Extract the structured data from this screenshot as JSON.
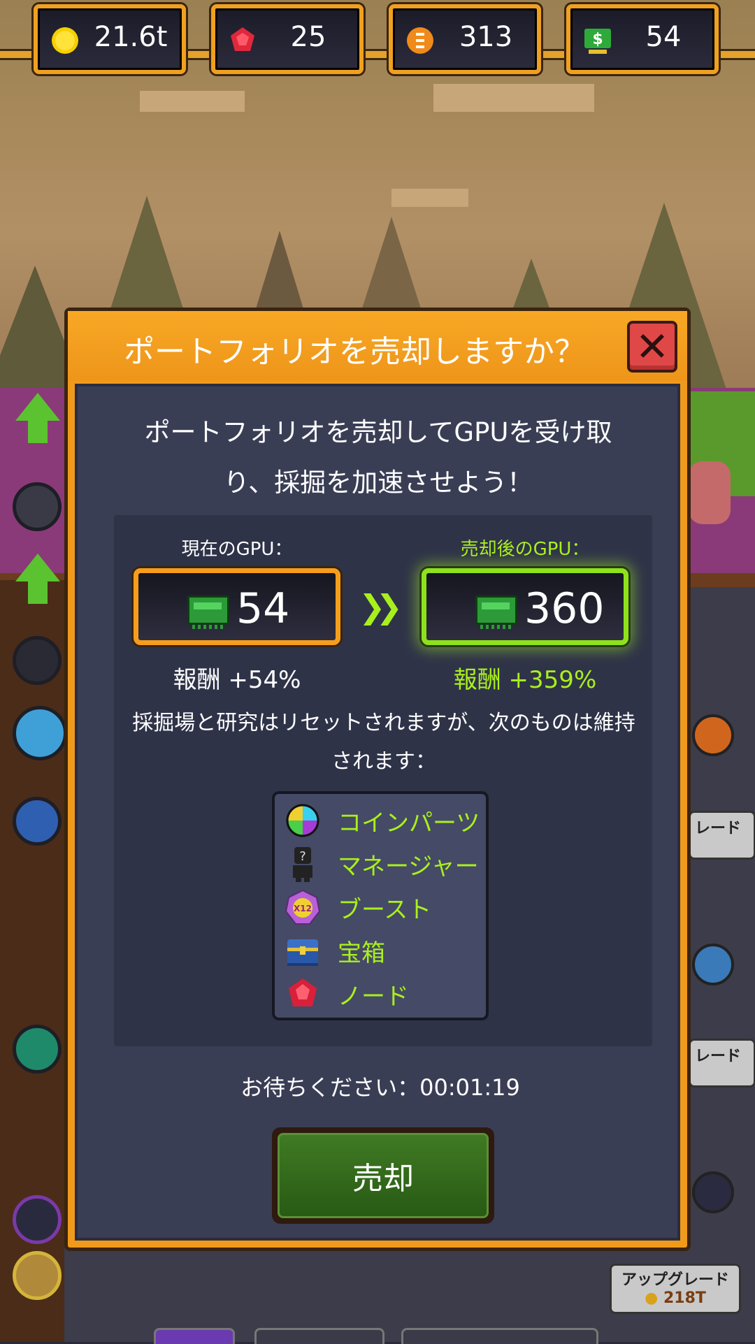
{
  "resources": [
    {
      "icon": "gold-coin-icon",
      "value": "21.6t"
    },
    {
      "icon": "red-gem-icon",
      "value": "25"
    },
    {
      "icon": "orange-token-icon",
      "value": "313"
    },
    {
      "icon": "cash-icon",
      "value": "54"
    }
  ],
  "modal": {
    "title": "ポートフォリオを売却しますか？",
    "intro_line1": "ポートフォリオを売却してGPUを受け取",
    "intro_line2": "り、採掘を加速させよう！",
    "current_gpu_label": "現在のGPU：",
    "current_gpu_value": "54",
    "current_reward": "報酬 +54%",
    "new_gpu_label": "売却後のGPU：",
    "new_gpu_value": "360",
    "new_reward": "報酬 +359%",
    "note_line1": "採掘場と研究はリセットされますが、次のものは維持",
    "note_line2": "されます：",
    "kept_items": [
      {
        "icon": "coin-parts-icon",
        "label": "コインパーツ"
      },
      {
        "icon": "manager-icon",
        "label": "マネージャー"
      },
      {
        "icon": "boost-icon",
        "label": "ブースト"
      },
      {
        "icon": "treasure-chest-icon",
        "label": "宝箱"
      },
      {
        "icon": "node-icon",
        "label": "ノード"
      }
    ],
    "wait_text": "お待ちください：00:01:19",
    "sell_label": "売却"
  },
  "background": {
    "upgrade_label": "アップグレード",
    "upgrade_cost": "218T",
    "partial_label_1": "レード",
    "partial_label_2": "レード"
  },
  "colors": {
    "orange_frame": "#f09a1c",
    "green_accent": "#a9f01c",
    "modal_body": "#3a3e55"
  }
}
